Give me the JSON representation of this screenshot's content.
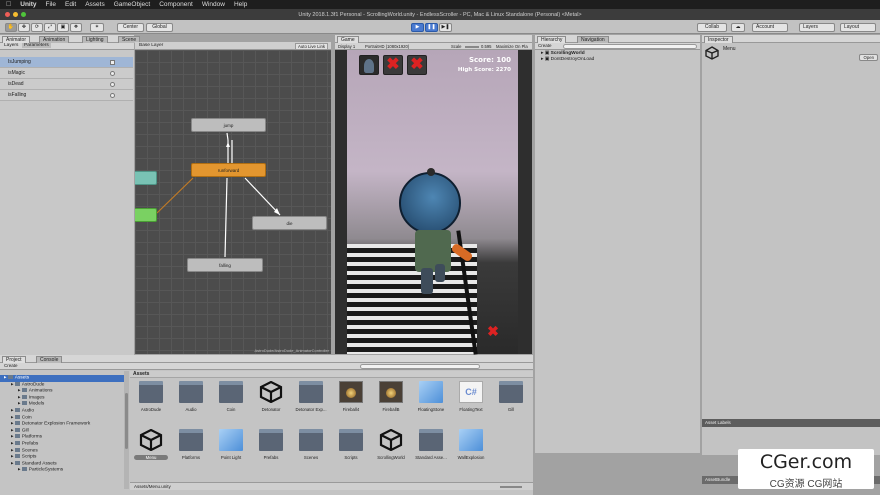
{
  "menubar": {
    "apple": "",
    "items": [
      "Unity",
      "File",
      "Edit",
      "Assets",
      "GameObject",
      "Component",
      "Window",
      "Help"
    ]
  },
  "titlebar": {
    "title": "Unity 2018.1.3f1 Personal - ScrollingWorld.unity - EndlessScroller - PC, Mac & Linux Standalone (Personal) <Metal>"
  },
  "toolbar": {
    "center": "Center",
    "global": "Global",
    "collab": "Collab",
    "account": "Account",
    "layers": "Layers",
    "layout": "Layout"
  },
  "left_panel": {
    "tabs": [
      "Animator",
      "Animation",
      "Lighting",
      "Scene"
    ],
    "subtabs": [
      "Layers",
      "Parameters"
    ],
    "params": [
      {
        "name": "IsJumping"
      },
      {
        "name": "isMagic"
      },
      {
        "name": "isDead"
      },
      {
        "name": "isFalling"
      }
    ]
  },
  "animator": {
    "layer": "Base Layer",
    "auto_live": "Auto Live Link",
    "footer": "AstroDude/AstroDude_AnimatorController",
    "nodes": {
      "jump": "jump",
      "running": "runforward",
      "die": "die",
      "falling": "falling"
    }
  },
  "game": {
    "tab": "Game",
    "display": "Display 1",
    "resolution": "PortraitHD (1080x1920)",
    "scale": "Scale",
    "scale_value": "0.595",
    "maximize": "Maximize On Pla",
    "score": "Score: 100",
    "high_score": "High Score: 2270"
  },
  "hierarchy": {
    "tabs": [
      "Hierarchy",
      "Navigation"
    ],
    "create": "Create",
    "items": [
      "ScrollingWorld",
      "DontDestroyOnLoad"
    ]
  },
  "inspector": {
    "tab": "Inspector",
    "object": "Menu",
    "open": "Open",
    "asset_labels": "Asset Labels",
    "asset_bundle": "AssetBundle"
  },
  "project": {
    "tabs": [
      "Project",
      "Console"
    ],
    "create": "Create",
    "breadcrumb": "Assets",
    "tree": [
      {
        "label": "Assets",
        "depth": 0,
        "selected": true
      },
      {
        "label": "AstroDude",
        "depth": 1
      },
      {
        "label": "Animations",
        "depth": 2
      },
      {
        "label": "Images",
        "depth": 2
      },
      {
        "label": "Models",
        "depth": 2
      },
      {
        "label": "Audio",
        "depth": 1
      },
      {
        "label": "Coin",
        "depth": 1
      },
      {
        "label": "Detonator Explosion Framework",
        "depth": 1
      },
      {
        "label": "Gill",
        "depth": 1
      },
      {
        "label": "Platforms",
        "depth": 1
      },
      {
        "label": "Prefabs",
        "depth": 1
      },
      {
        "label": "Scenes",
        "depth": 1
      },
      {
        "label": "Scripts",
        "depth": 1
      },
      {
        "label": "Standard Assets",
        "depth": 1
      },
      {
        "label": "ParticleSystems",
        "depth": 2
      }
    ],
    "assets_row1": [
      {
        "label": "AstroDude",
        "icon": "folder"
      },
      {
        "label": "Audio",
        "icon": "folder"
      },
      {
        "label": "Coin",
        "icon": "folder"
      },
      {
        "label": "Detonator",
        "icon": "unity-logo"
      },
      {
        "label": "Detonator Exp...",
        "icon": "folder"
      },
      {
        "label": "Fireball4",
        "icon": "prefab-image"
      },
      {
        "label": "FireballB",
        "icon": "prefab-image"
      },
      {
        "label": "FloatingStone",
        "icon": "cube"
      },
      {
        "label": "FloatingText",
        "icon": "cs-script"
      },
      {
        "label": "Gill",
        "icon": "folder"
      }
    ],
    "assets_row2": [
      {
        "label": "Menu",
        "icon": "unity-logo",
        "selected": true
      },
      {
        "label": "Platforms",
        "icon": "folder"
      },
      {
        "label": "Point Light",
        "icon": "cube"
      },
      {
        "label": "Prefabs",
        "icon": "folder"
      },
      {
        "label": "Scenes",
        "icon": "folder"
      },
      {
        "label": "Scripts",
        "icon": "folder"
      },
      {
        "label": "ScrollingWorld",
        "icon": "unity-logo"
      },
      {
        "label": "Standard Asse...",
        "icon": "folder"
      },
      {
        "label": "WallExplosion",
        "icon": "cube"
      }
    ],
    "footer_path": "Assets/Menu.unity",
    "csharp_glyph": "C#"
  },
  "watermark": {
    "brand": "CGer.com",
    "tagline": "CG资源 CG网站"
  },
  "colors": {
    "play_blue": "#4a7ad0",
    "state_orange": "#e3962f",
    "entry_green": "#7ad162",
    "any_teal": "#79c2b4"
  }
}
